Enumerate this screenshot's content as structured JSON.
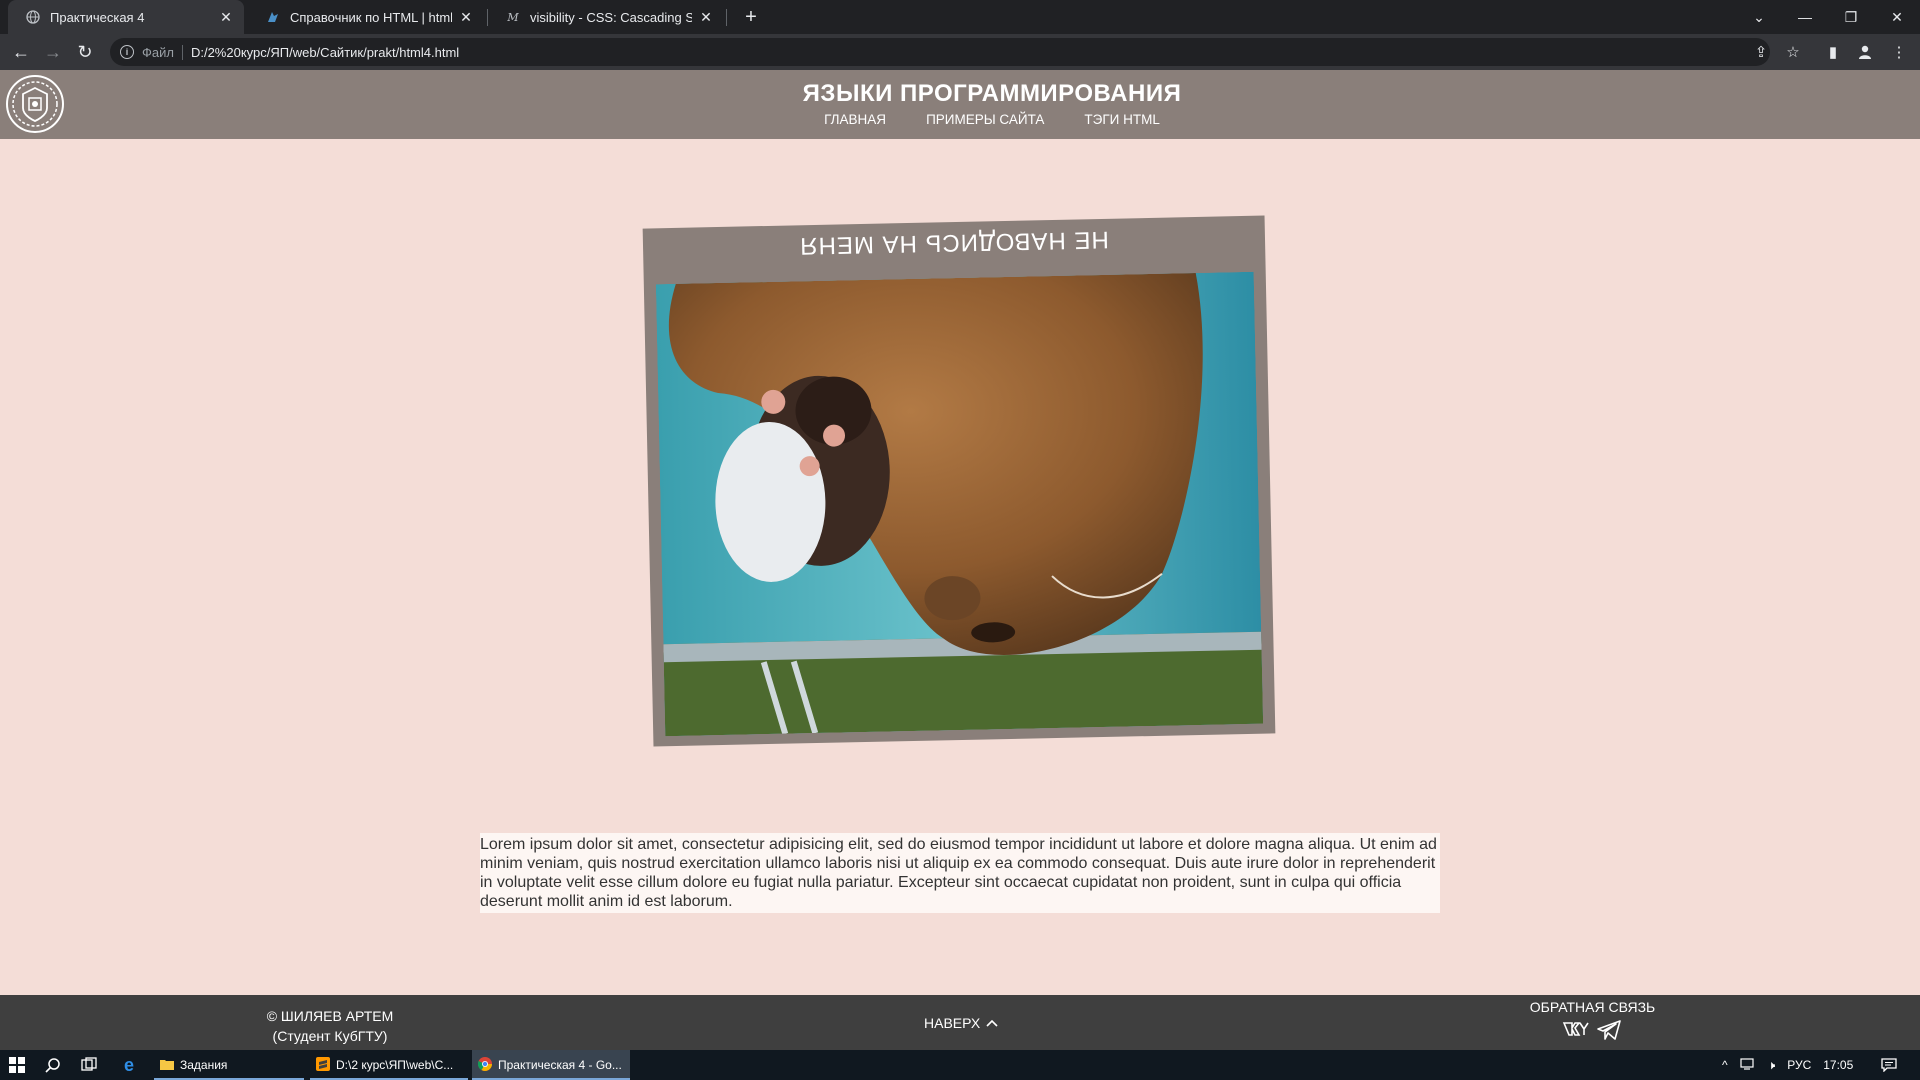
{
  "browser": {
    "tabs": [
      {
        "title": "Практическая 4",
        "icon": "globe-icon",
        "active": true
      },
      {
        "title": "Справочник по HTML | htmlboo",
        "icon": "htmlbook-icon",
        "active": false
      },
      {
        "title": "visibility - CSS: Cascading Style Sh",
        "icon": "mdn-icon",
        "active": false
      }
    ],
    "address": {
      "scheme": "Файл",
      "url": "D:/2%20курс/ЯП/web/Сайтик/prakt/html4.html"
    }
  },
  "site": {
    "title": "ЯЗЫКИ ПРОГРАММИРОВАНИЯ",
    "nav": [
      {
        "label": "ГЛАВНАЯ"
      },
      {
        "label": "ПРИМЕРЫ САЙТА"
      },
      {
        "label": "ТЭГИ HTML"
      }
    ],
    "card": {
      "caption": "НЕ НАВОДИСЬ НА МЕНЯ",
      "image": "capybara-with-rat-photo (flipped upside down)"
    },
    "lorem": "Lorem ipsum dolor sit amet, consectetur adipisicing elit, sed do eiusmod tempor incididunt ut labore et dolore magna aliqua. Ut enim ad minim veniam, quis nostrud exercitation ullamco laboris nisi ut aliquip ex ea commodo consequat. Duis aute irure dolor in reprehenderit in voluptate velit esse cillum dolore eu fugiat nulla pariatur. Excepteur sint occaecat cupidatat non proident, sunt in culpa qui officia deserunt mollit anim id est laborum.",
    "footer": {
      "author_line1": "© ШИЛЯЕВ АРТЕМ",
      "author_line2": "(Студент КубГТУ)",
      "up_label": "НАВЕРХ",
      "feedback_label": "ОБРАТНАЯ СВЯЗЬ",
      "social": [
        "vk-icon",
        "telegram-icon"
      ]
    }
  },
  "taskbar": {
    "apps": [
      {
        "label": "Задания",
        "icon": "folder-icon"
      },
      {
        "label": "D:\\2 курс\\ЯП\\web\\C...",
        "icon": "sublime-icon"
      },
      {
        "label": "Практическая 4 - Go...",
        "icon": "chrome-icon"
      }
    ],
    "lang": "РУС",
    "time": "17:05"
  },
  "colors": {
    "page_bg": "#f4ddd7",
    "header_bg": "#8a7f7a",
    "footer_bg": "#3f3f3f"
  }
}
